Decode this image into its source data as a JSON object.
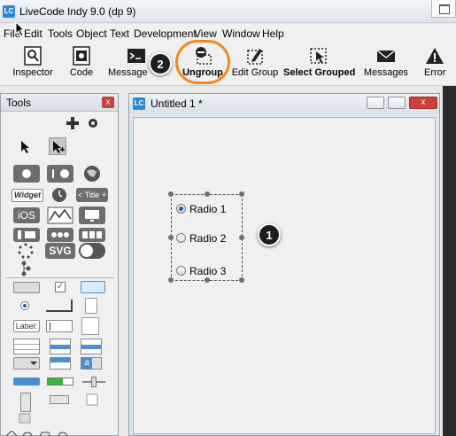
{
  "window": {
    "title": "LiveCode Indy 9.0 (dp 9)",
    "logo_text": "LC"
  },
  "menubar": {
    "items": [
      "File",
      "Edit",
      "Tools",
      "Object",
      "Text",
      "Development",
      "View",
      "Window",
      "Help"
    ]
  },
  "toolbar": {
    "items": [
      {
        "label": "Inspector",
        "icon": "inspector-icon"
      },
      {
        "label": "Code",
        "icon": "code-icon"
      },
      {
        "label": "Message",
        "icon": "message-box-icon"
      },
      {
        "label": "Ungroup",
        "icon": "ungroup-icon"
      },
      {
        "label": "Edit Group",
        "icon": "edit-group-icon"
      },
      {
        "label": "Select Grouped",
        "icon": "select-grouped-icon"
      },
      {
        "label": "Messages",
        "icon": "envelope-icon"
      },
      {
        "label": "Error",
        "icon": "warning-icon"
      }
    ]
  },
  "callouts": {
    "ungroup": "2",
    "group": "1"
  },
  "tools_palette": {
    "title": "Tools",
    "close_label": "x",
    "widget_labels": {
      "widget": "Widget",
      "title_bar": "< Title +",
      "ios": "iOS",
      "svg": "SVG",
      "label_field": "Label:"
    }
  },
  "stack": {
    "title": "Untitled 1 *",
    "close_label": "x",
    "radios": [
      {
        "label": "Radio 1",
        "checked": true
      },
      {
        "label": "Radio 2",
        "checked": false
      },
      {
        "label": "Radio 3",
        "checked": false
      }
    ]
  },
  "colors": {
    "accent_ring": "#f08a1e",
    "badge": "#1e1e1e",
    "lc_blue": "#2f86d6"
  }
}
